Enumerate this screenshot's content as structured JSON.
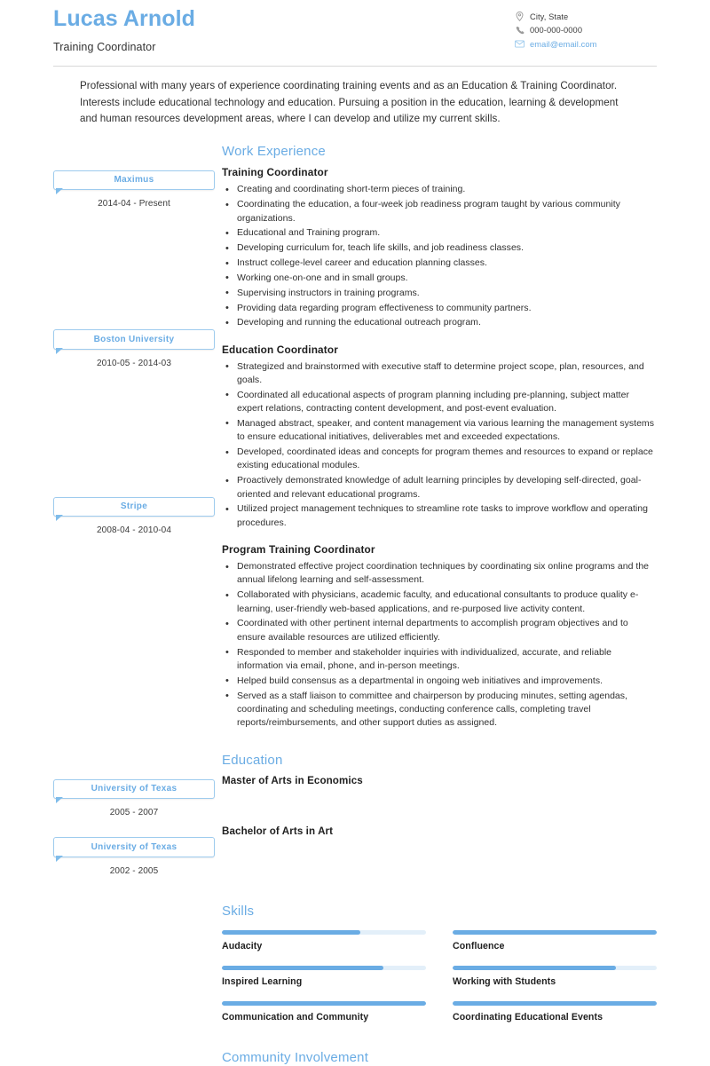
{
  "theme": {
    "accent": "#6aace4",
    "accent_light": "#9ecbee",
    "track": "#e3eff9",
    "text": "#2f2f2f",
    "rule": "#d8d8d8"
  },
  "header": {
    "full_name": "Lucas Arnold",
    "job_title": "Training Coordinator",
    "contacts": [
      {
        "icon": "location-pin-icon",
        "text": "City, State"
      },
      {
        "icon": "phone-icon",
        "text": "000-000-0000"
      },
      {
        "icon": "envelope-icon",
        "text": "email@email.com"
      }
    ]
  },
  "summary": {
    "text": "Professional with many years of experience coordinating training events and as an Education & Training Coordinator. Interests include educational technology and education. Pursuing a position in the education, learning & development and human resources development areas, where I can develop and utilize my current skills."
  },
  "work_experience": {
    "section_title": "Work Experience",
    "jobs": [
      {
        "company": "Maximus",
        "dates": "2014-04 - Present",
        "title": "Training Coordinator",
        "bullets": [
          "Creating and coordinating short-term pieces of training.",
          "Coordinating the education, a four-week job readiness program taught by various community organizations.",
          "Educational and Training program.",
          "Developing curriculum for, teach life skills, and job readiness classes.",
          "Instruct college-level career and education planning classes.",
          "Working one-on-one and in small groups.",
          "Supervising instructors in training programs.",
          "Providing data regarding program effectiveness to community partners.",
          "Developing and running the educational outreach program."
        ]
      },
      {
        "company": "Boston University",
        "dates": "2010-05 - 2014-03",
        "title": "Education Coordinator",
        "bullets": [
          "Strategized and brainstormed with executive staff to determine project scope, plan, resources, and goals.",
          "Coordinated all educational aspects of program planning including pre-planning, subject matter expert relations, contracting content development, and post-event evaluation.",
          "Managed abstract, speaker, and content management via various learning the management systems to ensure educational initiatives, deliverables met and exceeded expectations.",
          "Developed, coordinated ideas and concepts for program themes and resources to expand or replace existing educational modules.",
          "Proactively demonstrated knowledge of adult learning principles by developing self-directed, goal-oriented and relevant educational programs.",
          "Utilized project management techniques to streamline rote tasks to improve workflow and operating procedures."
        ]
      },
      {
        "company": "Stripe",
        "dates": "2008-04 - 2010-04",
        "title": "Program Training Coordinator",
        "bullets": [
          "Demonstrated effective project coordination techniques by coordinating six online programs and the annual lifelong learning and self-assessment.",
          "Collaborated with physicians, academic faculty, and educational consultants to produce quality e-learning, user-friendly web-based applications, and re-purposed live activity content.",
          "Coordinated with other pertinent internal departments to accomplish program objectives and to ensure available resources are utilized efficiently.",
          "Responded to member and stakeholder inquiries with individualized, accurate, and reliable information via email, phone, and in-person meetings.",
          "Helped build consensus as a departmental in ongoing web initiatives and improvements.",
          "Served as a staff liaison to committee and chairperson by producing minutes, setting agendas, coordinating and scheduling meetings, conducting conference calls, completing travel reports/reimbursements, and other support duties as assigned."
        ]
      }
    ]
  },
  "education": {
    "section_title": "Education",
    "entries": [
      {
        "school": "University of Texas",
        "dates": "2005 - 2007",
        "degree": "Master of Arts in Economics"
      },
      {
        "school": "University of Texas",
        "dates": "2002 - 2005",
        "degree": "Bachelor of Arts in Art"
      }
    ]
  },
  "skills": {
    "section_title": "Skills",
    "items": [
      {
        "name": "Audacity",
        "level": 68
      },
      {
        "name": "Confluence",
        "level": 100
      },
      {
        "name": "Inspired Learning",
        "level": 79
      },
      {
        "name": "Working with Students",
        "level": 80
      },
      {
        "name": "Communication and Community",
        "level": 100
      },
      {
        "name": "Coordinating Educational Events",
        "level": 100
      }
    ]
  },
  "next_section": {
    "title": "Community Involvement"
  }
}
